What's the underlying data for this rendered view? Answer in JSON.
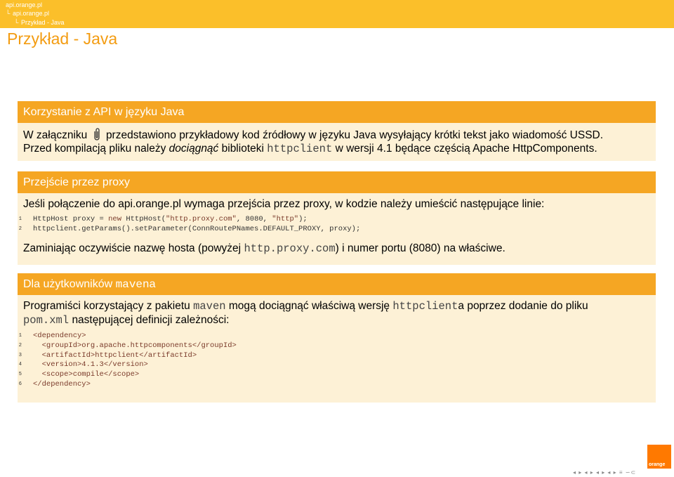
{
  "breadcrumb": {
    "root": "api.orange.pl",
    "level1": "api.orange.pl",
    "level2": "Przykład - Java"
  },
  "frame_title": "Przykład - Java",
  "block1": {
    "title": "Korzystanie z API w języku Java",
    "line1_a": "W załączniku",
    "line1_b": "przedstawiono przykładowy kod źródłowy w języku Java wysyłający krótki tekst jako wiadomość USSD.",
    "line2_a": "Przed kompilacją pliku należy",
    "line2_em": "dociągnąć",
    "line2_b": "biblioteki",
    "line2_code": "httpclient",
    "line2_c": "w wersji 4.1 będące częścią Apache HttpComponents."
  },
  "block2": {
    "title": "Przejście przez proxy",
    "intro": "Jeśli połączenie do api.orange.pl wymaga przejścia przez proxy, w kodzie należy umieścić następujące linie:",
    "code": [
      {
        "n": "1",
        "a": "HttpHost proxy = ",
        "kw": "new",
        "b": " HttpHost(",
        "s1": "\"http.proxy.com\"",
        "c": ", 8080, ",
        "s2": "\"http\"",
        "d": ");"
      },
      {
        "n": "2",
        "a": "httpclient.getParams().setParameter(ConnRoutePNames.DEFAULT_PROXY, proxy);"
      }
    ],
    "outro_a": "Zaminiając oczywiście nazwę hosta (powyżej",
    "outro_code": "http.proxy.com",
    "outro_b": ") i numer portu (8080) na właściwe."
  },
  "block3": {
    "title_a": "Dla użytkowników",
    "title_code": "maven",
    "title_b": "a",
    "p_a": "Programiści korzystający z pakietu",
    "p_code1": "maven",
    "p_b": "mogą dociągnąć właściwą wersję",
    "p_code2": "httpclient",
    "p_c": "a poprzez dodanie do pliku",
    "p_code3": "pom.xml",
    "p_d": "następującej definicji zależności:",
    "code": [
      {
        "n": "1",
        "t": "<dependency>"
      },
      {
        "n": "2",
        "t": "  <groupId>org.apache.httpcomponents</groupId>"
      },
      {
        "n": "3",
        "t": "  <artifactId>httpclient</artifactId>"
      },
      {
        "n": "4",
        "t": "  <version>4.1.3</version>"
      },
      {
        "n": "5",
        "t": "  <scope>compile</scope>"
      },
      {
        "n": "6",
        "t": "</dependency>"
      }
    ]
  },
  "logo": {
    "text": "orange",
    "color": "#ff7900"
  },
  "nav": {
    "symbols": "◂ ▸ ◂ ▸ ◂ ▸ ◂ ▸ ≡ ∽⊂"
  },
  "colors": {
    "topbar": "#fbbf2a",
    "block_header": "#f5a623",
    "block_body": "#fdf1d6",
    "title": "#f39c12"
  }
}
